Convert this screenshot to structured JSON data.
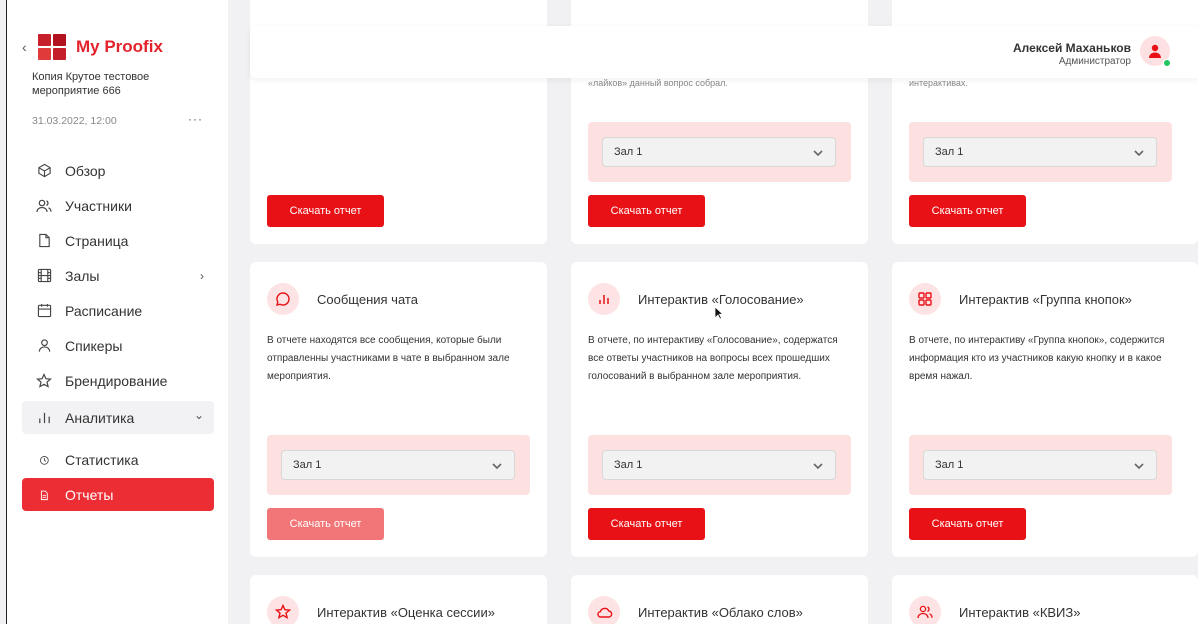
{
  "brand": {
    "name": "My Proofix"
  },
  "event": {
    "name": "Копия Крутое тестовое мероприятие 666",
    "date": "31.03.2022, 12:00",
    "menu": "···"
  },
  "nav": {
    "overview": "Обзор",
    "participants": "Участники",
    "page": "Страница",
    "halls": "Залы",
    "schedule": "Расписание",
    "speakers": "Спикеры",
    "branding": "Брендирование",
    "analytics": "Аналитика",
    "statistics": "Статистика",
    "reports": "Отчеты",
    "arrow_right": "›",
    "arrow_down": "⌄"
  },
  "user": {
    "name": "Алексей Маханьков",
    "role": "Администратор"
  },
  "colors": {
    "accent": "#e81116",
    "active_nav": "#ec2d34",
    "hall_bg": "#fde0e0",
    "online": "#22c55e"
  },
  "cards_top": [
    {
      "tail": ""
    },
    {
      "tail": "«лайков» данный вопрос собрал.",
      "hall": "Зал 1",
      "button": "Скачать отчет"
    },
    {
      "tail": "интерактивах.",
      "hall": "Зал 1",
      "button": "Скачать отчет"
    }
  ],
  "cards_top_first_button": "Скачать отчет",
  "cards_mid": [
    {
      "icon": "chat-icon",
      "title": "Сообщения чата",
      "desc": "В отчете находятся все сообщения, которые были отправленны участниками в чате в выбранном зале мероприятия.",
      "hall": "Зал 1",
      "button": "Скачать отчет"
    },
    {
      "icon": "bar-chart-icon",
      "title": "Интерактив «Голосование»",
      "desc": "В отчете, по интерактиву «Голосование», содержатся все ответы участников на вопросы всех прошедших голосований в выбранном зале мероприятия.",
      "hall": "Зал 1",
      "button": "Скачать отчет"
    },
    {
      "icon": "grid-icon",
      "title": "Интерактив «Группа кнопок»",
      "desc": "В отчете, по интерактиву «Группа кнопок», содержится информация кто из участников какую кнопку и в какое время нажал.",
      "hall": "Зал 1",
      "button": "Скачать отчет"
    }
  ],
  "cards_bottom": [
    {
      "icon": "star-icon",
      "title": "Интерактив «Оценка сессии»"
    },
    {
      "icon": "cloud-icon",
      "title": "Интерактив «Облако слов»"
    },
    {
      "icon": "users-icon",
      "title": "Интерактив «КВИЗ»"
    }
  ]
}
